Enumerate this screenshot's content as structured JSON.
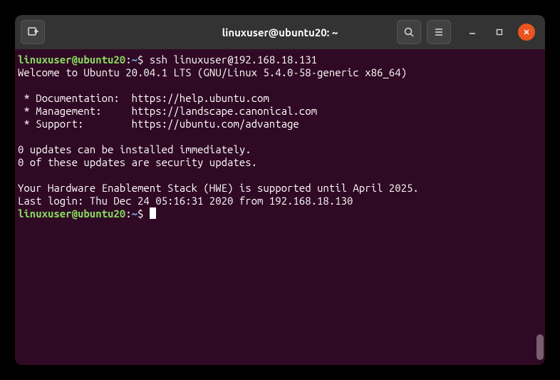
{
  "titlebar": {
    "title": "linuxuser@ubuntu20: ~"
  },
  "prompt": {
    "user_host": "linuxuser@ubuntu20",
    "colon": ":",
    "path": "~",
    "dollar": "$ "
  },
  "terminal": {
    "command": "ssh linuxuser@192.168.18.131",
    "welcome": "Welcome to Ubuntu 20.04.1 LTS (GNU/Linux 5.4.0-58-generic x86_64)",
    "blank": "",
    "doc_line": " * Documentation:  https://help.ubuntu.com",
    "mgmt_line": " * Management:     https://landscape.canonical.com",
    "support_line": " * Support:        https://ubuntu.com/advantage",
    "updates1": "0 updates can be installed immediately.",
    "updates2": "0 of these updates are security updates.",
    "hwe": "Your Hardware Enablement Stack (HWE) is supported until April 2025.",
    "last_login": "Last login: Thu Dec 24 05:16:31 2020 from 192.168.18.130"
  }
}
